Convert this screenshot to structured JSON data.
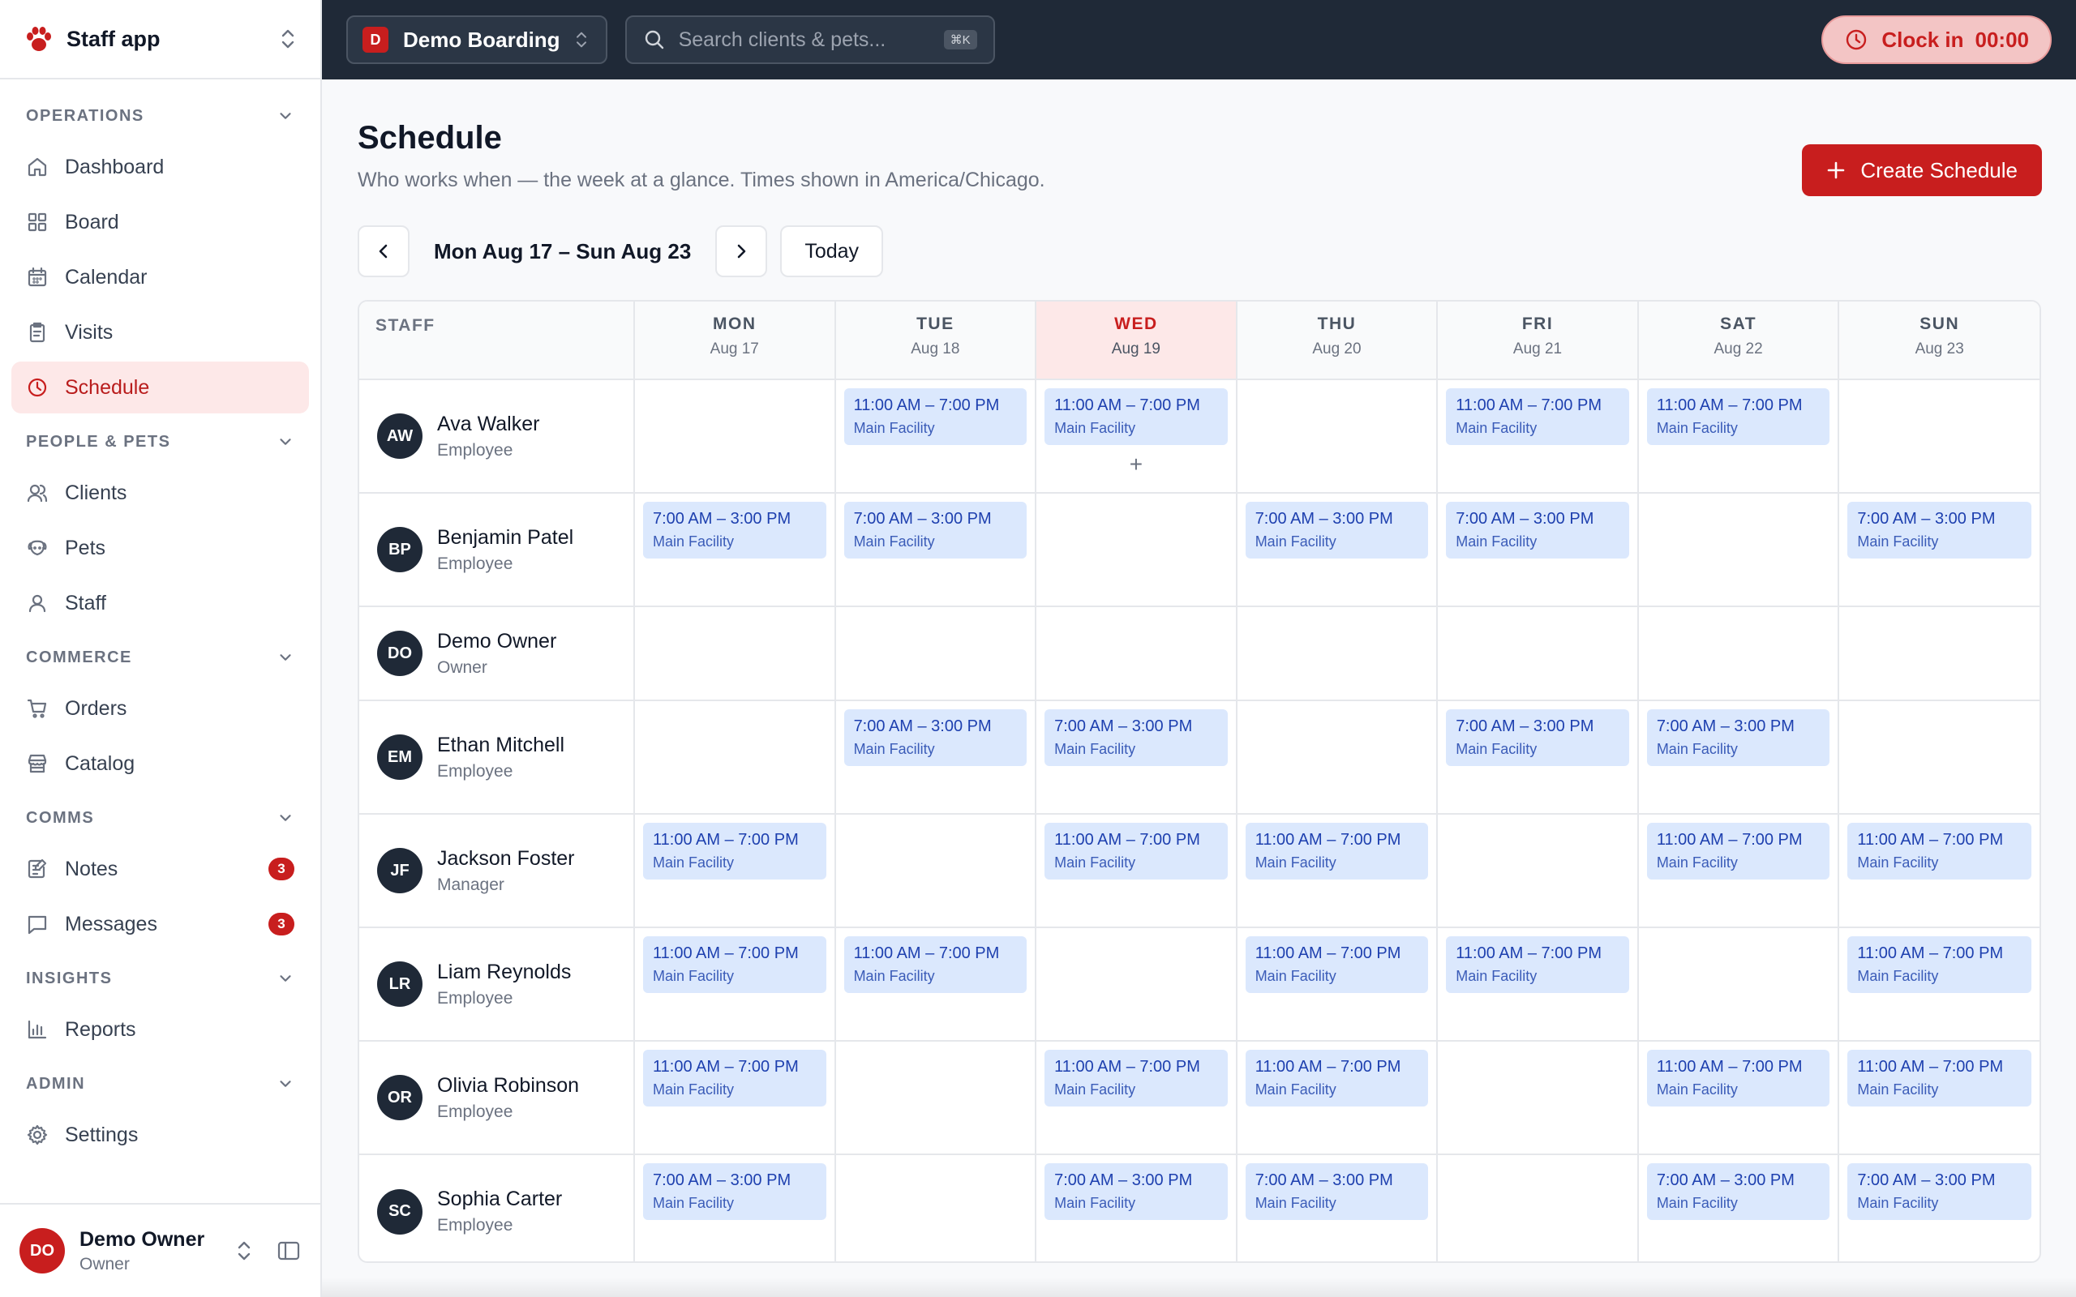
{
  "app": {
    "name": "Staff app"
  },
  "sidebar": {
    "sections": [
      {
        "title": "OPERATIONS",
        "items": [
          {
            "label": "Dashboard",
            "icon": "home-icon"
          },
          {
            "label": "Board",
            "icon": "grid-icon"
          },
          {
            "label": "Calendar",
            "icon": "calendar-icon"
          },
          {
            "label": "Visits",
            "icon": "clipboard-icon"
          },
          {
            "label": "Schedule",
            "icon": "clock-icon",
            "active": true
          }
        ]
      },
      {
        "title": "PEOPLE & PETS",
        "items": [
          {
            "label": "Clients",
            "icon": "users-icon"
          },
          {
            "label": "Pets",
            "icon": "dog-icon"
          },
          {
            "label": "Staff",
            "icon": "staff-icon"
          }
        ]
      },
      {
        "title": "COMMERCE",
        "items": [
          {
            "label": "Orders",
            "icon": "cart-icon"
          },
          {
            "label": "Catalog",
            "icon": "store-icon"
          }
        ]
      },
      {
        "title": "COMMS",
        "items": [
          {
            "label": "Notes",
            "icon": "notes-icon",
            "badge": "3"
          },
          {
            "label": "Messages",
            "icon": "message-icon",
            "badge": "3"
          }
        ]
      },
      {
        "title": "INSIGHTS",
        "items": [
          {
            "label": "Reports",
            "icon": "bar-chart-icon"
          }
        ]
      },
      {
        "title": "ADMIN",
        "items": [
          {
            "label": "Settings",
            "icon": "gear-icon"
          }
        ]
      }
    ],
    "user": {
      "initials": "DO",
      "name": "Demo Owner",
      "role": "Owner"
    }
  },
  "topbar": {
    "business_initial": "D",
    "business_name": "Demo Boarding",
    "search_placeholder": "Search clients & pets...",
    "search_shortcut": "⌘K",
    "clockin_label": "Clock in",
    "clockin_time": "00:00"
  },
  "page": {
    "title": "Schedule",
    "subtitle": "Who works when — the week at a glance. Times shown in America/Chicago.",
    "create_label": "Create Schedule",
    "range": "Mon Aug 17 – Sun Aug 23",
    "today_label": "Today"
  },
  "schedule": {
    "staff_header": "STAFF",
    "days": [
      {
        "name": "MON",
        "date": "Aug 17"
      },
      {
        "name": "TUE",
        "date": "Aug 18"
      },
      {
        "name": "WED",
        "date": "Aug 19",
        "today": true
      },
      {
        "name": "THU",
        "date": "Aug 20"
      },
      {
        "name": "FRI",
        "date": "Aug 21"
      },
      {
        "name": "SAT",
        "date": "Aug 22"
      },
      {
        "name": "SUN",
        "date": "Aug 23"
      }
    ],
    "shift_types": {
      "late": "11:00 AM – 7:00 PM",
      "early": "7:00 AM – 3:00 PM"
    },
    "location": "Main Facility",
    "staff": [
      {
        "initials": "AW",
        "name": "Ava Walker",
        "role": "Employee",
        "shifts": [
          null,
          "late",
          "late",
          null,
          "late",
          "late",
          null
        ]
      },
      {
        "initials": "BP",
        "name": "Benjamin Patel",
        "role": "Employee",
        "shifts": [
          "early",
          "early",
          null,
          "early",
          "early",
          null,
          "early"
        ]
      },
      {
        "initials": "DO",
        "name": "Demo Owner",
        "role": "Owner",
        "shifts": [
          null,
          null,
          null,
          null,
          null,
          null,
          null
        ]
      },
      {
        "initials": "EM",
        "name": "Ethan Mitchell",
        "role": "Employee",
        "shifts": [
          null,
          "early",
          "early",
          null,
          "early",
          "early",
          null
        ]
      },
      {
        "initials": "JF",
        "name": "Jackson Foster",
        "role": "Manager",
        "shifts": [
          "late",
          null,
          "late",
          "late",
          null,
          "late",
          "late"
        ]
      },
      {
        "initials": "LR",
        "name": "Liam Reynolds",
        "role": "Employee",
        "shifts": [
          "late",
          "late",
          null,
          "late",
          "late",
          null,
          "late"
        ]
      },
      {
        "initials": "OR",
        "name": "Olivia Robinson",
        "role": "Employee",
        "shifts": [
          "late",
          null,
          "late",
          "late",
          null,
          "late",
          "late"
        ]
      },
      {
        "initials": "SC",
        "name": "Sophia Carter",
        "role": "Employee",
        "shifts": [
          "early",
          null,
          "early",
          "early",
          null,
          "early",
          "early"
        ]
      }
    ]
  }
}
